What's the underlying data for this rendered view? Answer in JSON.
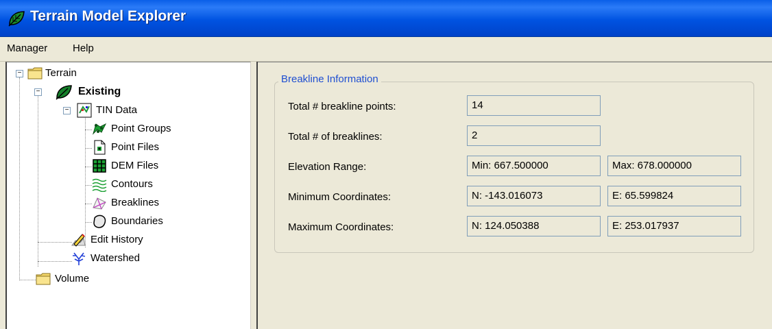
{
  "window": {
    "title": "Terrain Model Explorer"
  },
  "menu": {
    "items": [
      "Manager",
      "Help"
    ]
  },
  "tree": {
    "root": "Terrain",
    "existing": "Existing",
    "tin_data": "TIN Data",
    "point_groups": "Point Groups",
    "point_files": "Point Files",
    "dem_files": "DEM Files",
    "contours": "Contours",
    "breaklines": "Breaklines",
    "boundaries": "Boundaries",
    "edit_history": "Edit History",
    "watershed": "Watershed",
    "volume": "Volume"
  },
  "breakline_info": {
    "group_title": "Breakline Information",
    "total_points_label": "Total # breakline points:",
    "total_points_value": "14",
    "total_breaklines_label": "Total # of breaklines:",
    "total_breaklines_value": "2",
    "elevation_label": "Elevation Range:",
    "elevation_min": "Min: 667.500000",
    "elevation_max": "Max: 678.000000",
    "min_coords_label": "Minimum Coordinates:",
    "min_n": "N: -143.016073",
    "min_e": "E: 65.599824",
    "max_coords_label": "Maximum Coordinates:",
    "max_n": "N: 124.050388",
    "max_e": "E: 253.017937"
  },
  "colors": {
    "title_bar": "#0053e1",
    "group_title": "#1f4fd1",
    "panel_bg": "#ece9d8"
  }
}
